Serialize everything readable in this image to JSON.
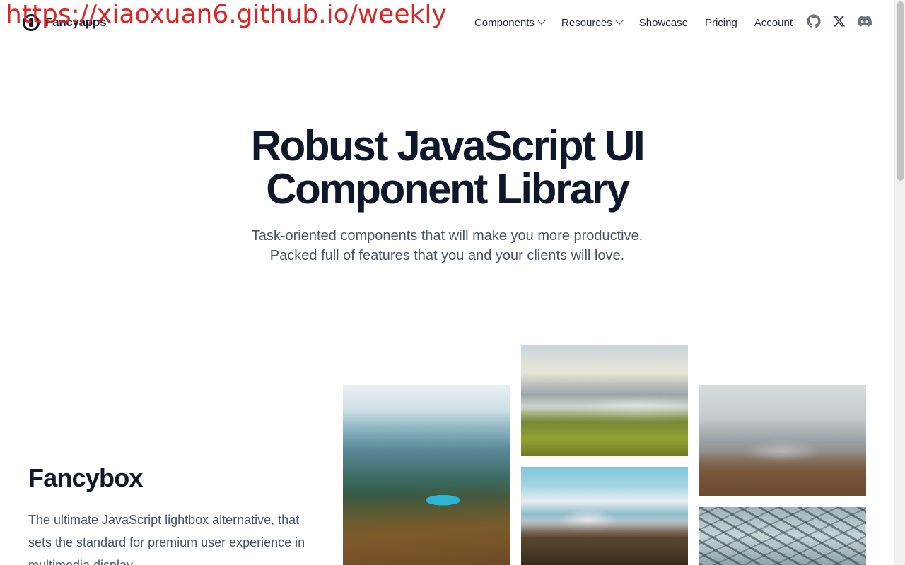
{
  "watermark": "https://xiaoxuan6.github.io/weekly",
  "brand": {
    "name": "Fancyapps"
  },
  "nav": {
    "items": [
      {
        "label": "Components",
        "has_dropdown": true
      },
      {
        "label": "Resources",
        "has_dropdown": true
      },
      {
        "label": "Showcase",
        "has_dropdown": false
      },
      {
        "label": "Pricing",
        "has_dropdown": false
      },
      {
        "label": "Account",
        "has_dropdown": false
      }
    ],
    "socials": [
      "github-icon",
      "x-icon",
      "discord-icon"
    ]
  },
  "hero": {
    "title_line1": "Robust JavaScript UI",
    "title_line2": "Component Library",
    "subtitle_line1": "Task-oriented components that will make you more productive.",
    "subtitle_line2": "Packed full of features that you and your clients will love."
  },
  "feature": {
    "title": "Fancybox",
    "description": "The ultimate JavaScript lightbox alternative, that sets the standard for premium user experience in multimedia display."
  },
  "gallery": [
    "mountain-lake-photo",
    "foggy-meadow-photo",
    "cloudy-peaks-photo",
    "snowy-mountains-photo",
    "leaves-photo"
  ],
  "colors": {
    "heading": "#0f172a",
    "body": "#475569",
    "watermark": "#dc2626"
  }
}
